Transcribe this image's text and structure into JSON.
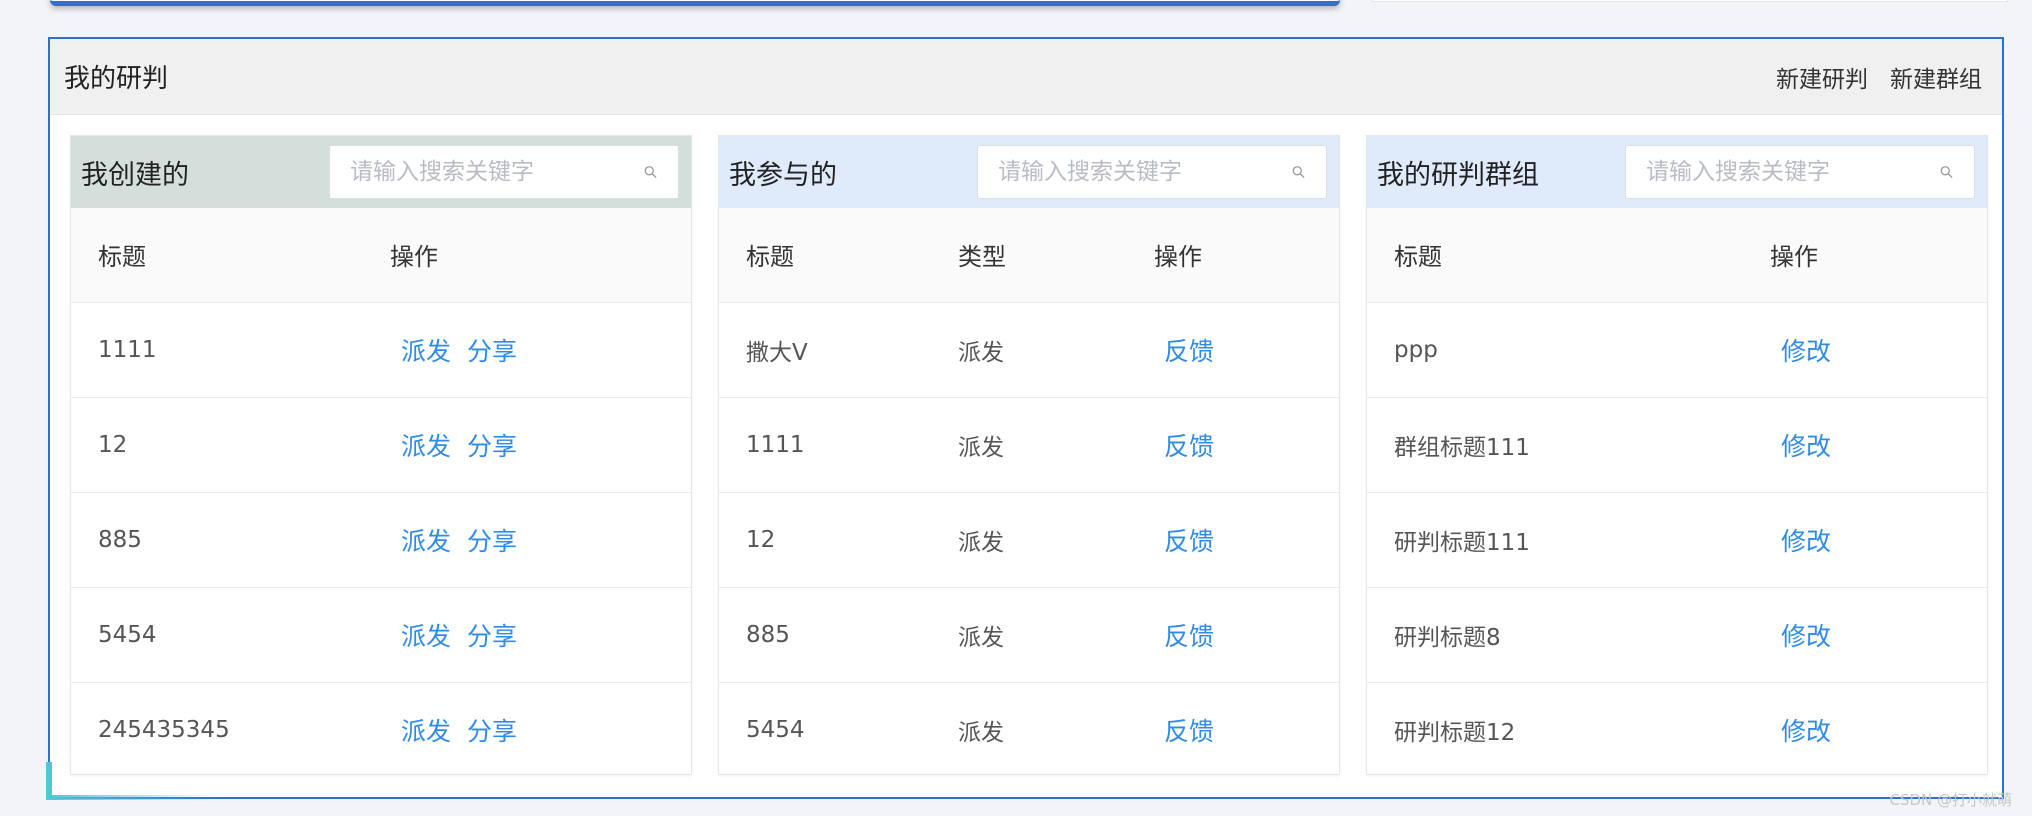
{
  "section": {
    "title": "我的研判",
    "actions": [
      "新建研判",
      "新建群组"
    ]
  },
  "panels": {
    "created": {
      "title": "我创建的",
      "search_placeholder": "请输入搜索关键字",
      "columns": [
        "标题",
        "操作"
      ],
      "rows": [
        {
          "title": "1111",
          "actions": [
            "派发",
            "分享"
          ]
        },
        {
          "title": "12",
          "actions": [
            "派发",
            "分享"
          ]
        },
        {
          "title": "885",
          "actions": [
            "派发",
            "分享"
          ]
        },
        {
          "title": "5454",
          "actions": [
            "派发",
            "分享"
          ]
        },
        {
          "title": "245435345",
          "actions": [
            "派发",
            "分享"
          ]
        }
      ]
    },
    "joined": {
      "title": "我参与的",
      "search_placeholder": "请输入搜索关键字",
      "columns": [
        "标题",
        "类型",
        "操作"
      ],
      "rows": [
        {
          "title": "撒大V",
          "type": "派发",
          "action": "反馈"
        },
        {
          "title": "1111",
          "type": "派发",
          "action": "反馈"
        },
        {
          "title": "12",
          "type": "派发",
          "action": "反馈"
        },
        {
          "title": "885",
          "type": "派发",
          "action": "反馈"
        },
        {
          "title": "5454",
          "type": "派发",
          "action": "反馈"
        }
      ]
    },
    "groups": {
      "title": "我的研判群组",
      "search_placeholder": "请输入搜索关键字",
      "columns": [
        "标题",
        "操作"
      ],
      "rows": [
        {
          "title": "ppp",
          "action": "修改"
        },
        {
          "title": "群组标题111",
          "action": "修改"
        },
        {
          "title": "研判标题111",
          "action": "修改"
        },
        {
          "title": "研判标题8",
          "action": "修改"
        },
        {
          "title": "研判标题12",
          "action": "修改"
        }
      ]
    }
  },
  "watermark": "CSDN @打小就萌",
  "colors": {
    "frame_border": "#2f6fd0",
    "link": "#2f8bea",
    "created_header": "#d4dfdb",
    "other_header": "#dfeafb"
  }
}
